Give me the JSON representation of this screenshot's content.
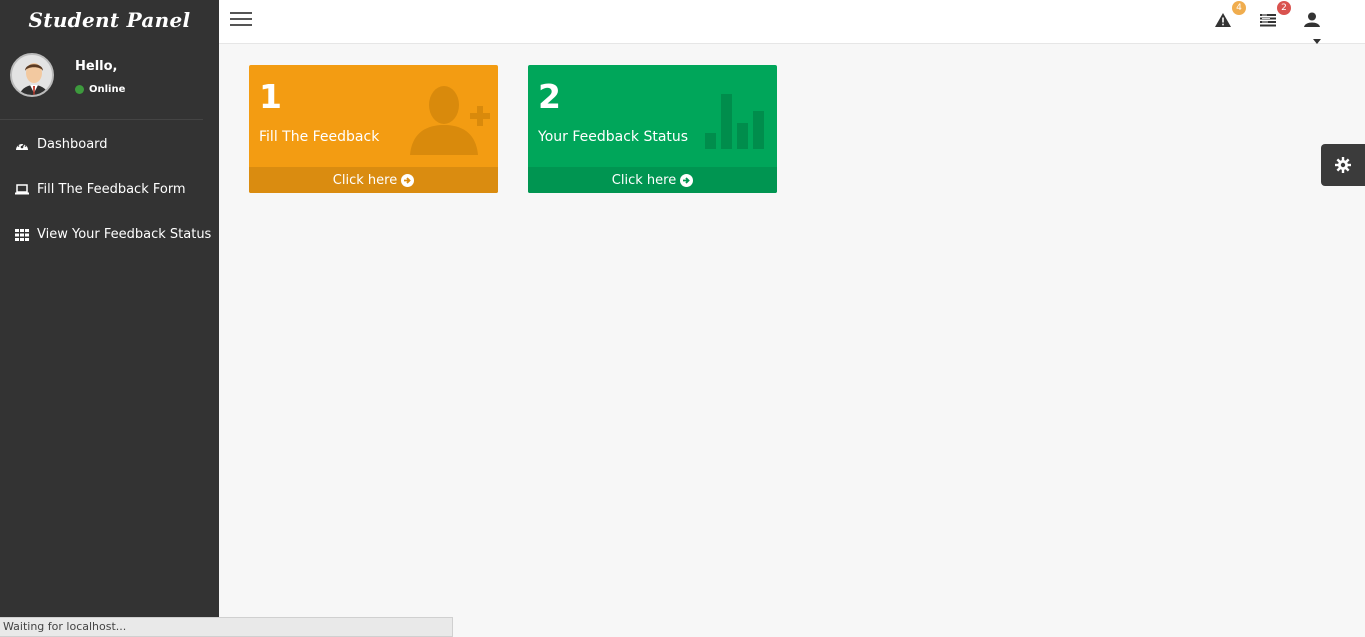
{
  "sidebar": {
    "brand": "Student Panel",
    "greeting": "Hello,",
    "status": "Online",
    "status_color": "#3d9a3d",
    "items": [
      {
        "label": "Dashboard",
        "icon": "dashboard-icon"
      },
      {
        "label": "Fill The Feedback Form",
        "icon": "laptop-icon"
      },
      {
        "label": "View Your Feedback Status",
        "icon": "table-grid-icon"
      }
    ]
  },
  "topbar": {
    "alerts_count": "4",
    "messages_count": "2",
    "icons": [
      "menu-hamburger-icon",
      "warning-icon",
      "list-icon",
      "user-icon",
      "caret-down-icon"
    ]
  },
  "cards": [
    {
      "number": "1",
      "label": "Fill The Feedback",
      "footer": "Click here",
      "color": "#f39c12",
      "icon": "user-plus-icon"
    },
    {
      "number": "2",
      "label": "Your Feedback Status",
      "footer": "Click here",
      "color": "#00a65a",
      "icon": "bar-chart-icon"
    }
  ],
  "browser_status": "Waiting for localhost..."
}
